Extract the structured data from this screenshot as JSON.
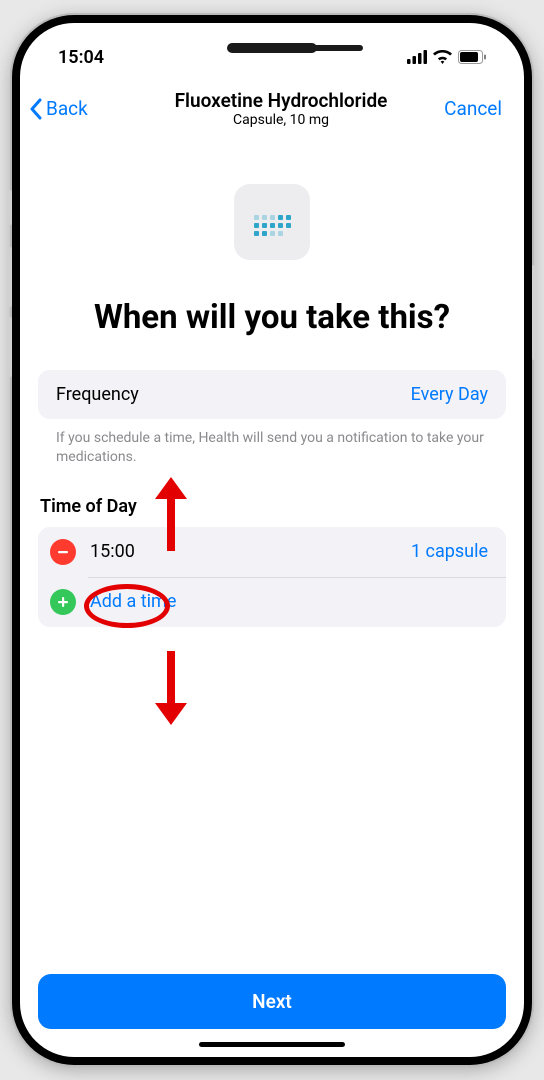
{
  "status": {
    "time": "15:04"
  },
  "nav": {
    "back_label": "Back",
    "title": "Fluoxetine Hydrochloride",
    "subtitle": "Capsule, 10 mg",
    "cancel_label": "Cancel"
  },
  "headline": "When will you take this?",
  "frequency": {
    "label": "Frequency",
    "value": "Every Day"
  },
  "hint": "If you schedule a time, Health will send you a notification to take your medications.",
  "time_section": {
    "header": "Time of Day",
    "rows": [
      {
        "time": "15:00",
        "dose": "1 capsule"
      }
    ],
    "add_label": "Add a time"
  },
  "next_button": "Next"
}
